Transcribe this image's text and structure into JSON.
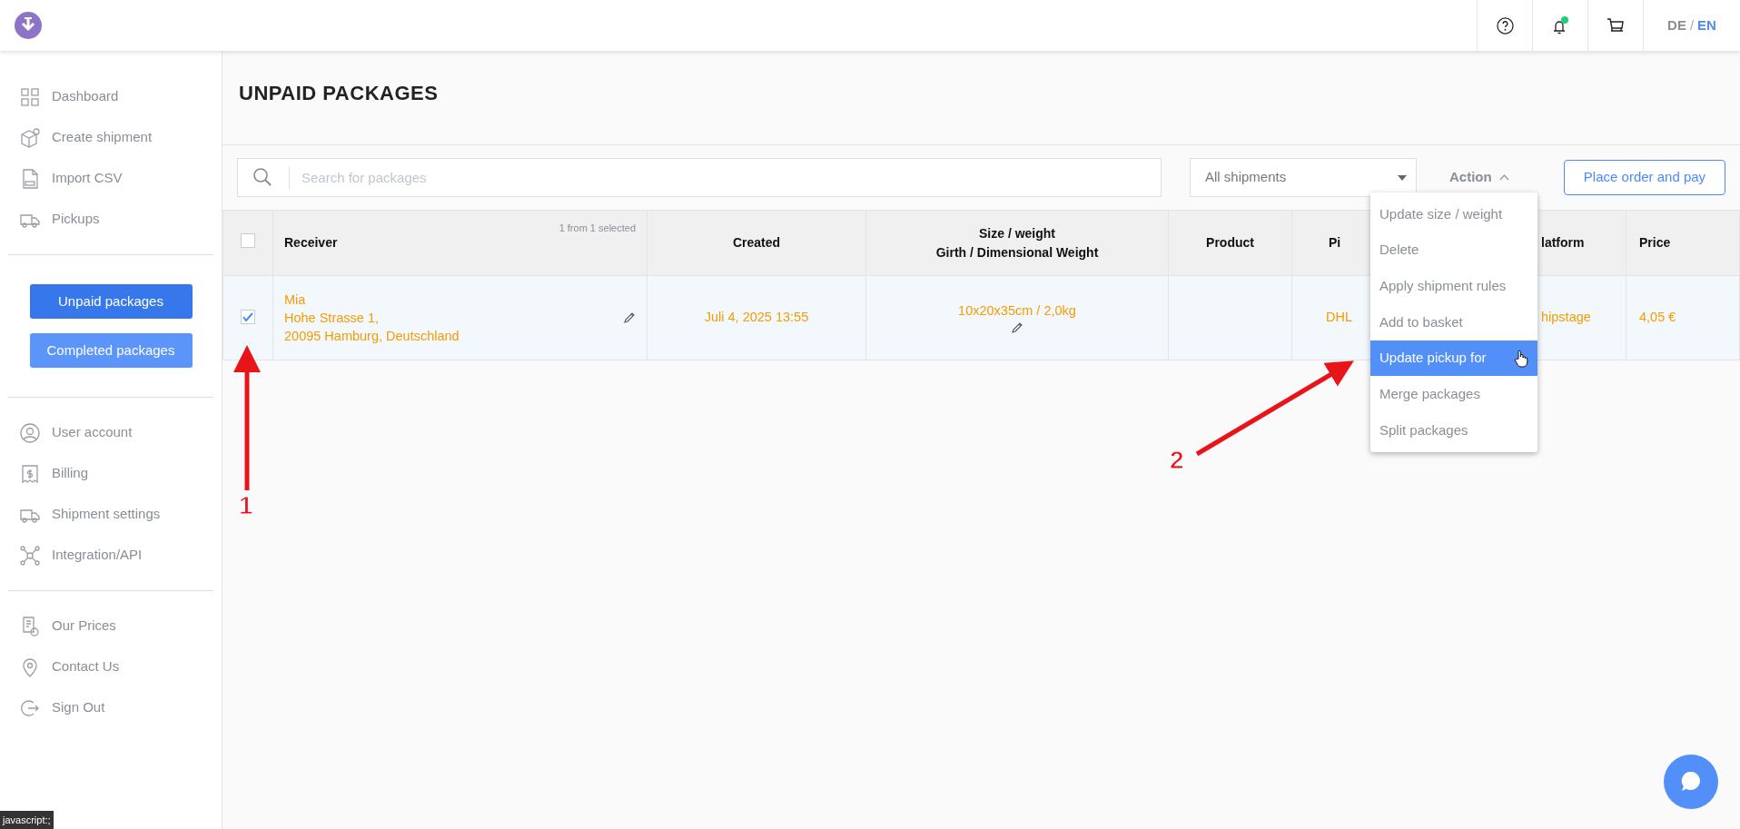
{
  "header": {
    "languages": [
      {
        "label": "DE",
        "selected": false
      },
      {
        "label": "EN",
        "selected": true
      }
    ],
    "language_separator": "/",
    "notification_unread": true
  },
  "sidebar": {
    "groups": [
      {
        "kind": "links",
        "items": [
          {
            "label": "Dashboard"
          },
          {
            "label": "Create shipment"
          },
          {
            "label": "Import CSV"
          },
          {
            "label": "Pickups"
          }
        ]
      },
      {
        "kind": "buttons",
        "items": [
          {
            "label": "Unpaid packages",
            "selected": true
          },
          {
            "label": "Completed packages",
            "selected": false
          }
        ]
      },
      {
        "kind": "links",
        "items": [
          {
            "label": "User account"
          },
          {
            "label": "Billing"
          },
          {
            "label": "Shipment settings"
          },
          {
            "label": "Integration/API"
          }
        ]
      },
      {
        "kind": "links",
        "items": [
          {
            "label": "Our Prices"
          },
          {
            "label": "Contact Us"
          },
          {
            "label": "Sign Out"
          }
        ]
      }
    ]
  },
  "page": {
    "title": "UNPAID PACKAGES"
  },
  "toolbar": {
    "search": {
      "placeholder": "Search for packages"
    },
    "filter": {
      "value": "All shipments"
    },
    "action": {
      "label": "Action",
      "expanded": true
    },
    "primary_button": "Place order and pay"
  },
  "action_menu": [
    {
      "label": "Update size / weight",
      "selected": false
    },
    {
      "label": "Delete",
      "selected": false
    },
    {
      "label": "Apply shipment rules",
      "selected": false
    },
    {
      "label": "Add to basket",
      "selected": false
    },
    {
      "label": "Update pickup for",
      "selected": true
    },
    {
      "label": "Merge packages",
      "selected": false
    },
    {
      "label": "Split packages",
      "selected": false
    }
  ],
  "table": {
    "all_checked": false,
    "selection_note": "1 from 1 selected",
    "columns": [
      "Receiver",
      "Created",
      "Size / weight\nGirth / Dimensional Weight",
      "Product",
      "Pi",
      "latform",
      "Price"
    ],
    "rows": [
      {
        "checked": true,
        "receiver": [
          "Mia",
          "Hohe Strasse 1,",
          "20095 Hamburg, Deutschland"
        ],
        "created": "Juli 4, 2025 13:55",
        "size": "10x20x35cm / 2,0kg",
        "column_6": "DHL",
        "column_7": "hipstage",
        "price": "4,05 €"
      }
    ]
  },
  "annotations": [
    {
      "label": "1"
    },
    {
      "label": "2"
    }
  ],
  "status_tooltip": "javascript:;"
}
